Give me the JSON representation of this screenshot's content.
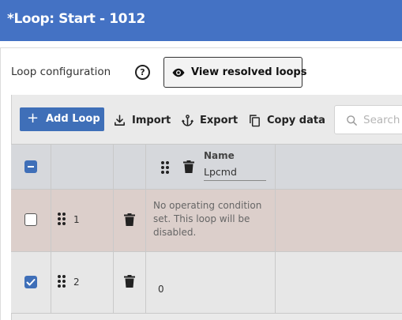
{
  "window": {
    "title": "*Loop: Start - 1012"
  },
  "config": {
    "label": "Loop configuration",
    "help_glyph": "?",
    "view_resolved_label": "View resolved loops"
  },
  "toolbar": {
    "add_label": "Add Loop",
    "add_glyph": "+",
    "import_label": "Import",
    "export_label": "Export",
    "copy_label": "Copy data",
    "search_placeholder": "Search"
  },
  "table": {
    "header": {
      "select_all_state": "partial",
      "name_label": "Name",
      "name_filter_value": "Lpcmd"
    },
    "rows": [
      {
        "index": "1",
        "checked": false,
        "name": "",
        "message": "No operating condition set. This loop will be disabled."
      },
      {
        "index": "2",
        "checked": true,
        "name": "0",
        "message": ""
      }
    ]
  },
  "colors": {
    "titlebar": "#4472c4",
    "primary_button": "#3f6fb8",
    "header_row": "#d6d8dc",
    "disabled_row": "#dccfcb",
    "normal_row": "#e7e7e7"
  },
  "icons": {
    "help": "help-circle-icon",
    "view": "eye-icon",
    "add": "plus-icon",
    "import": "download-icon",
    "export": "anchor-icon",
    "copy": "copy-icon",
    "search": "search-icon",
    "drag": "drag-handle-icon",
    "delete": "trash-icon"
  }
}
